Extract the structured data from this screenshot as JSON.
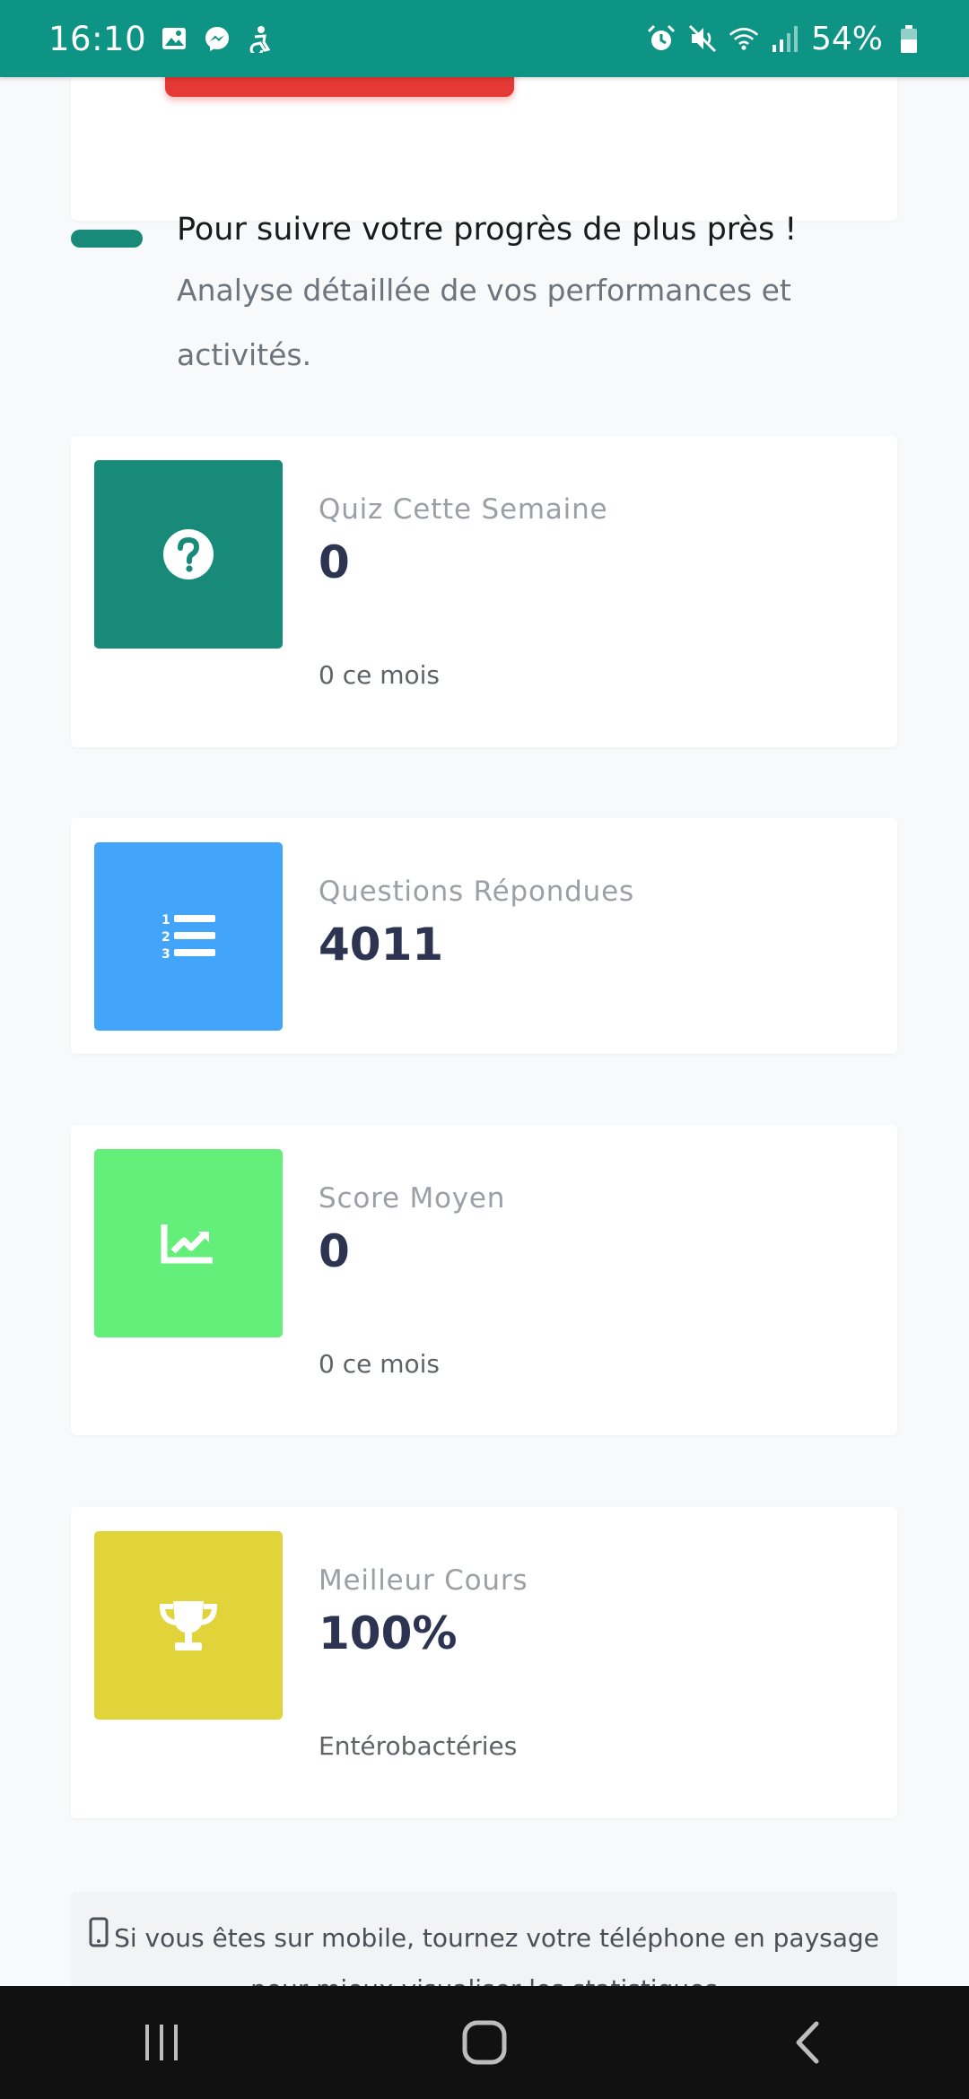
{
  "status_bar": {
    "time": "16:10",
    "battery": "54%",
    "left_icons": [
      "gallery-icon",
      "messenger-icon",
      "accessibility-icon"
    ],
    "right_icons": [
      "alarm-icon",
      "mute-icon",
      "wifi-icon",
      "signal-icon",
      "battery-icon"
    ],
    "background": "#0e9484"
  },
  "intro": {
    "title": "Pour suivre votre progrès de plus près !",
    "description": "Analyse détaillée de vos performances et activités.",
    "accent": "#178a79"
  },
  "stats": [
    {
      "label": "Quiz Cette Semaine",
      "value": "0",
      "sub": "0 ce mois",
      "icon": "question-circle-icon",
      "color": "#178a79"
    },
    {
      "label": "Questions Répondues",
      "value": "4011",
      "sub": "",
      "icon": "numbered-list-icon",
      "color": "#42a5fa"
    },
    {
      "label": "Score Moyen",
      "value": "0",
      "sub": "0 ce mois",
      "icon": "chart-line-icon",
      "color": "#63ef7a"
    },
    {
      "label": "Meilleur Cours",
      "value": "100%",
      "sub": "Entérobactéries",
      "icon": "trophy-icon",
      "color": "#e0d43a"
    }
  ],
  "notice": {
    "icon": "mobile-phone-icon",
    "text": "Si vous êtes sur mobile, tournez votre téléphone en paysage pour mieux visualiser les statistiques"
  },
  "nav": {
    "buttons": [
      "recent-apps-icon",
      "home-icon",
      "back-icon"
    ]
  }
}
